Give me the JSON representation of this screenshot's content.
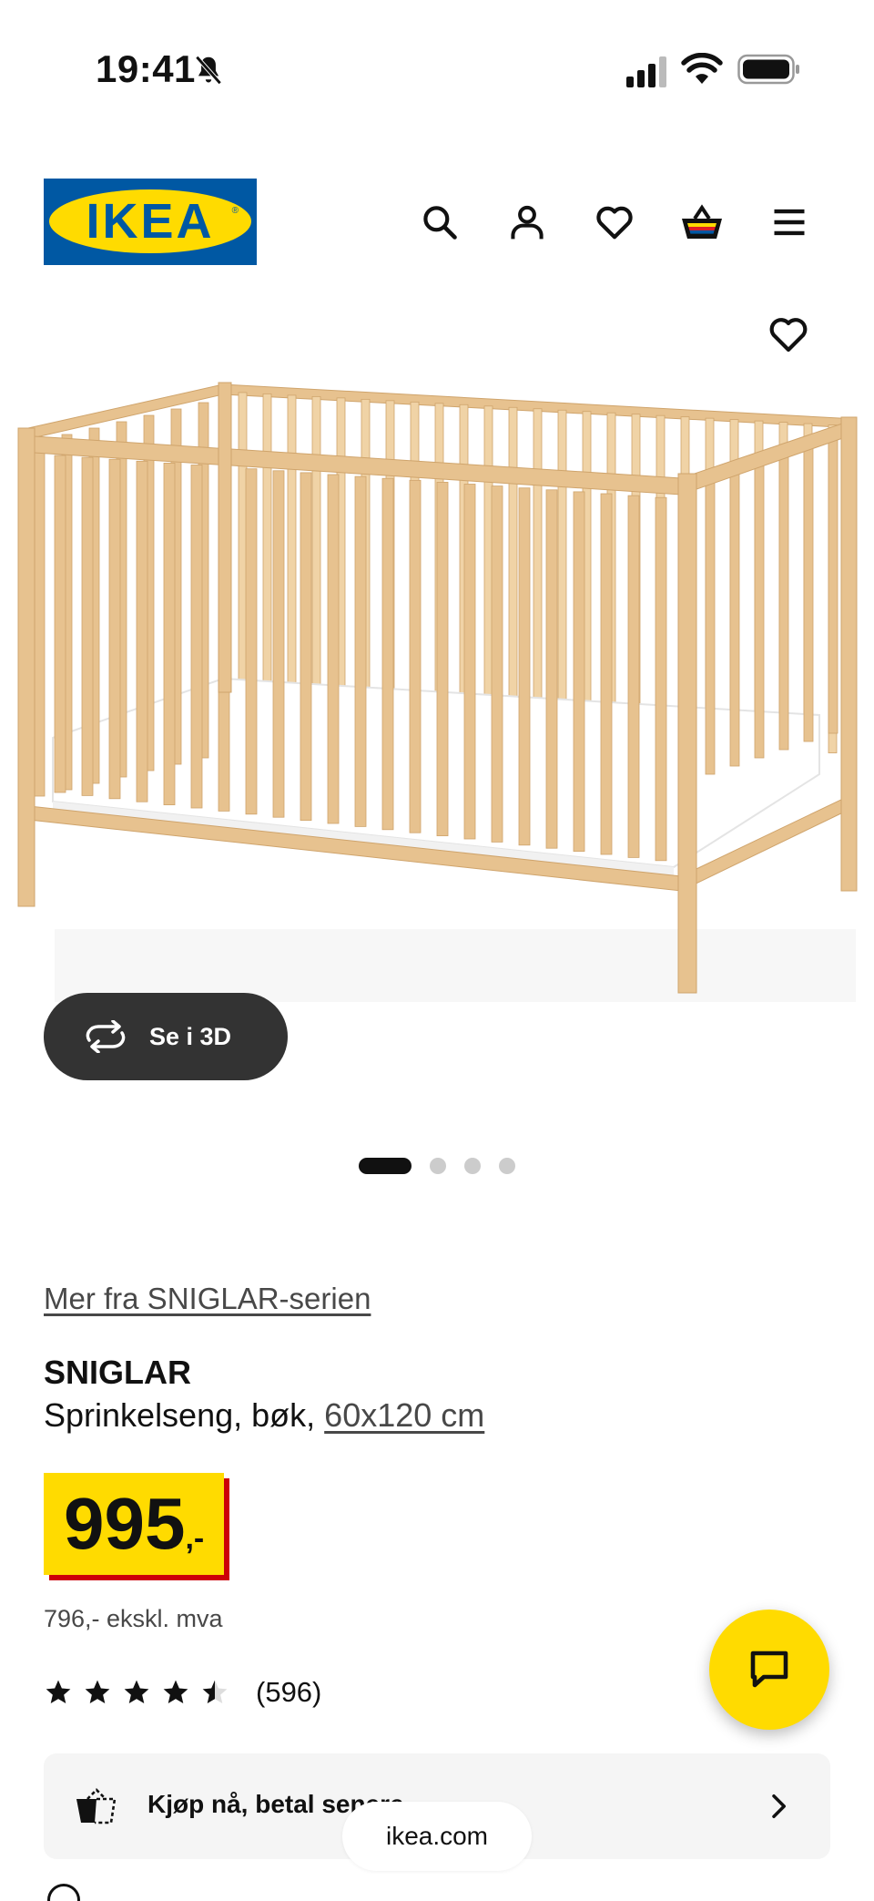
{
  "status_bar": {
    "time": "19:41",
    "icons": [
      "bell-slash-icon",
      "cellular-signal-icon",
      "wifi-icon",
      "battery-icon"
    ]
  },
  "header": {
    "logo_text": "IKEA",
    "icons": [
      "search-icon",
      "account-icon",
      "wishlist-heart-icon",
      "shopping-basket-icon",
      "menu-icon"
    ]
  },
  "gallery": {
    "favourite_icon": "heart-outline-icon",
    "view_3d_label": "Se i 3D",
    "view_3d_icon": "rotate-arrows-icon",
    "total_images": 4,
    "active_index": 0
  },
  "product": {
    "series_link": "Mer fra SNIGLAR-serien",
    "name": "SNIGLAR",
    "description": "Sprinkelseng, bøk,",
    "size": "60x120 cm",
    "price_integer": "995",
    "price_decimal": ",-",
    "price_ex_vat": "796,- ekskl. mva",
    "rating": 4.5,
    "rating_max": 5,
    "review_count": "(596)"
  },
  "bnpl": {
    "label": "Kjøp nå, betal senere",
    "icon": "cart-dashed-icon"
  },
  "chat": {
    "icon": "chat-bubble-icon"
  },
  "browser": {
    "url": "ikea.com"
  },
  "colors": {
    "ikea_blue": "#0058a3",
    "ikea_yellow": "#ffdb00",
    "price_shadow_red": "#cc0008",
    "button_dark": "#333333",
    "text_secondary": "#484848"
  }
}
